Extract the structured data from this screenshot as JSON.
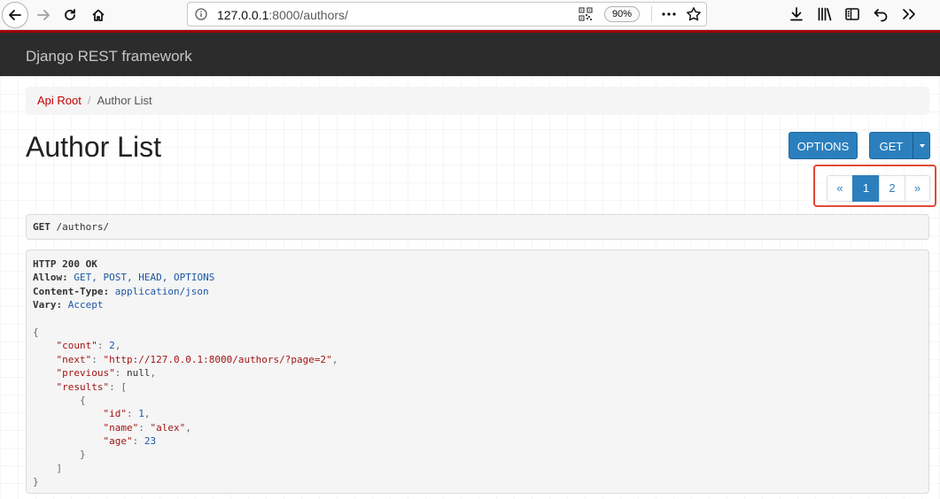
{
  "browser": {
    "url_prefix": "127.0.0.1",
    "url_rest": ":8000/authors/",
    "zoom": "90%"
  },
  "navbar": {
    "brand": "Django REST framework"
  },
  "breadcrumb": {
    "root": "Api Root",
    "separator": "/",
    "current": "Author List"
  },
  "page": {
    "title": "Author List",
    "options_button": "OPTIONS",
    "get_button": "GET"
  },
  "pagination": {
    "prev": "«",
    "pages": [
      "1",
      "2"
    ],
    "active": "1",
    "next": "»"
  },
  "request": {
    "method": "GET",
    "path": " /authors/"
  },
  "response": {
    "status": "HTTP 200 OK",
    "headers": [
      {
        "name": "Allow:",
        "value": " GET, POST, HEAD, OPTIONS"
      },
      {
        "name": "Content-Type:",
        "value": " application/json"
      },
      {
        "name": "Vary:",
        "value": " Accept"
      }
    ],
    "body": {
      "open_brace": "{",
      "count_key": "\"count\"",
      "count_val": "2",
      "next_key": "\"next\"",
      "next_val": "\"http://127.0.0.1:8000/authors/?page=2\"",
      "previous_key": "\"previous\"",
      "previous_val": "null",
      "results_key": "\"results\"",
      "results_open": "[",
      "item_open": "{",
      "id_key": "\"id\"",
      "id_val": "1",
      "name_key": "\"name\"",
      "name_val": "\"alex\"",
      "age_key": "\"age\"",
      "age_val": "23",
      "item_close": "}",
      "results_close": "]",
      "close_brace": "}"
    }
  },
  "colors": {
    "navbar_bg": "#2c2c2c",
    "navbar_accent": "#a30000",
    "primary_button": "#2c7fbd",
    "link": "#c20000",
    "highlight": "#e24a34"
  }
}
